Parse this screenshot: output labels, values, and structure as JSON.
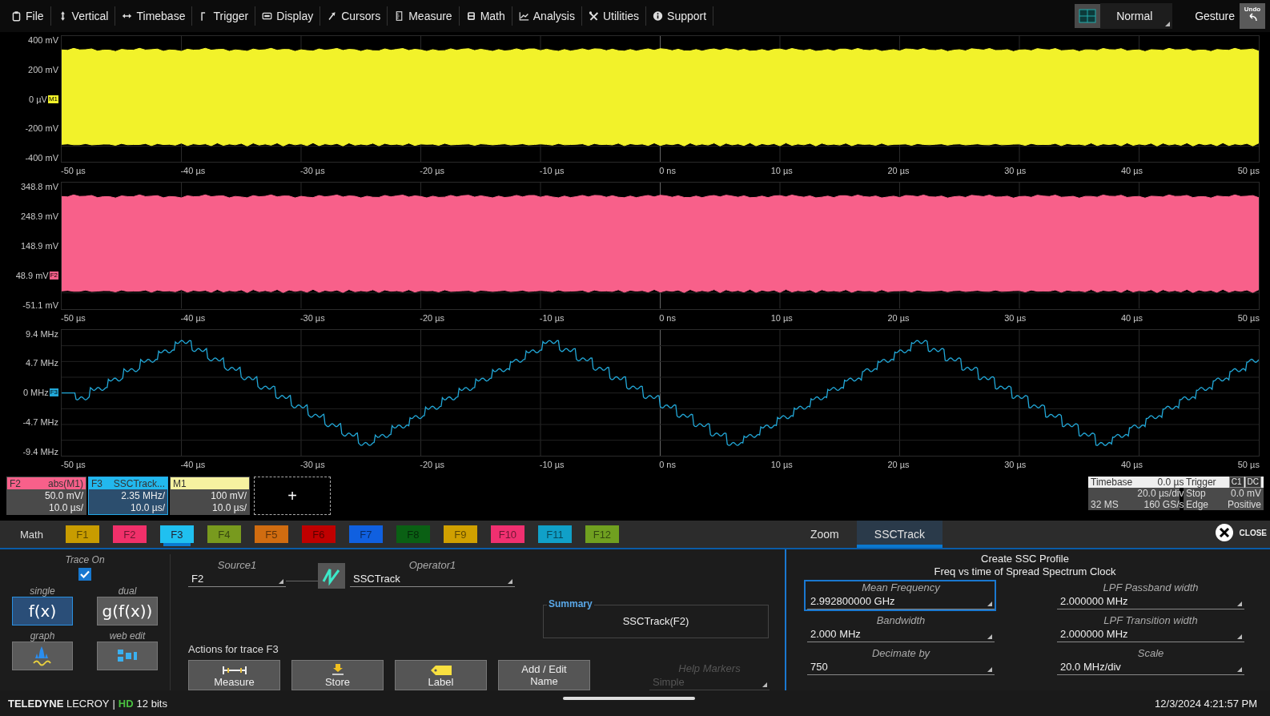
{
  "menu": [
    {
      "label": "File"
    },
    {
      "label": "Vertical"
    },
    {
      "label": "Timebase"
    },
    {
      "label": "Trigger"
    },
    {
      "label": "Display"
    },
    {
      "label": "Cursors"
    },
    {
      "label": "Measure"
    },
    {
      "label": "Math"
    },
    {
      "label": "Analysis"
    },
    {
      "label": "Utilities"
    },
    {
      "label": "Support"
    }
  ],
  "display_mode": "Normal",
  "gesture": "Gesture",
  "undo": "Undo",
  "grids": [
    {
      "kind": "band",
      "color": "#f2f22a",
      "y_labels": [
        {
          "text": "400 mV"
        },
        {
          "text": "200 mV"
        },
        {
          "text": "0 µV",
          "marker": "M1"
        },
        {
          "text": "-200 mV"
        },
        {
          "text": "-400 mV"
        }
      ],
      "x_labels": [
        "-50 µs",
        "-40 µs",
        "-30 µs",
        "-20 µs",
        "-10 µs",
        "0 ns",
        "10 µs",
        "20 µs",
        "30 µs",
        "40 µs",
        "50 µs"
      ]
    },
    {
      "kind": "band",
      "color": "#f8608a",
      "y_labels": [
        {
          "text": "348.8 mV"
        },
        {
          "text": "248.9 mV"
        },
        {
          "text": "148.9 mV"
        },
        {
          "text": "48.9 mV",
          "marker": "F2"
        },
        {
          "text": "-51.1 mV"
        }
      ],
      "x_labels": [
        "-50 µs",
        "-40 µs",
        "-30 µs",
        "-20 µs",
        "-10 µs",
        "0 ns",
        "10 µs",
        "20 µs",
        "30 µs",
        "40 µs",
        "50 µs"
      ]
    },
    {
      "kind": "staircase",
      "color": "#22a8d8",
      "y_labels": [
        {
          "text": "9.4 MHz"
        },
        {
          "text": "4.7 MHz"
        },
        {
          "text": "0 MHz",
          "marker": "F3"
        },
        {
          "text": "-4.7 MHz"
        },
        {
          "text": "-9.4 MHz"
        }
      ],
      "x_labels": [
        "-50 µs",
        "-40 µs",
        "-30 µs",
        "-20 µs",
        "-10 µs",
        "0 ns",
        "10 µs",
        "20 µs",
        "30 µs",
        "40 µs",
        "50 µs"
      ]
    }
  ],
  "descriptors": [
    {
      "name": "F2",
      "source": "abs(M1)",
      "color": "#f8608a",
      "scale": "50.0 mV/",
      "time": "10.0 µs/",
      "selected": false
    },
    {
      "name": "F3",
      "source": "SSCTrack...",
      "color": "#22b8ee",
      "scale": "2.35 MHz/",
      "time": "10.0 µs/",
      "selected": true
    },
    {
      "name": "M1",
      "color": "#f6f2a0",
      "scale": "100 mV/",
      "time": "10.0 µs/",
      "selected": false
    }
  ],
  "add_trace": "+",
  "timebase": {
    "title": "Timebase",
    "delay": "0.0 µs",
    "scale": "20.0 µs/div",
    "samples": "32 MS",
    "rate": "160 GS/s"
  },
  "trigger": {
    "title": "Trigger",
    "source": "C1",
    "coupling": "DC",
    "mode": "Stop",
    "level": "0.0 mV",
    "type": "Edge",
    "slope": "Positive"
  },
  "math_label": "Math",
  "function_tabs": [
    {
      "label": "F1",
      "color": "#c89c00",
      "selected": false
    },
    {
      "label": "F2",
      "color": "#f0306a",
      "selected": false
    },
    {
      "label": "F3",
      "color": "#20c0f0",
      "selected": true
    },
    {
      "label": "F4",
      "color": "#789a1e",
      "selected": false
    },
    {
      "label": "F5",
      "color": "#d06c10",
      "selected": false
    },
    {
      "label": "F6",
      "color": "#c00000",
      "selected": false
    },
    {
      "label": "F7",
      "color": "#1060e0",
      "selected": false
    },
    {
      "label": "F8",
      "color": "#0a6014",
      "selected": false
    },
    {
      "label": "F9",
      "color": "#d0a000",
      "selected": false
    },
    {
      "label": "F10",
      "color": "#f03070",
      "selected": false
    },
    {
      "label": "F11",
      "color": "#10a0c8",
      "selected": false
    },
    {
      "label": "F12",
      "color": "#70a020",
      "selected": false
    }
  ],
  "dialog_tabs": [
    {
      "label": "Zoom",
      "selected": false
    },
    {
      "label": "SSCTrack",
      "selected": true
    }
  ],
  "close": "CLOSE",
  "trace_on": {
    "label": "Trace On",
    "checked": true
  },
  "modes": [
    {
      "label": "single",
      "button": "f(x)",
      "kind": "text",
      "selected": true
    },
    {
      "label": "dual",
      "button": "g(f(x))",
      "kind": "text",
      "selected": false
    },
    {
      "label": "graph",
      "kind": "graph",
      "selected": false
    },
    {
      "label": "web edit",
      "kind": "web",
      "selected": false
    }
  ],
  "source": {
    "label": "Source1",
    "value": "F2"
  },
  "operator": {
    "label": "Operator1",
    "value": "SSCTrack"
  },
  "summary": {
    "label": "Summary",
    "value": "SSCTrack(F2)"
  },
  "actions_label": "Actions for trace F3",
  "actions": [
    {
      "label": "Measure",
      "kind": "measure"
    },
    {
      "label": "Store",
      "kind": "store"
    },
    {
      "label": "Label",
      "kind": "label"
    },
    {
      "label": "Add / Edit Name",
      "kind": "text"
    }
  ],
  "help_markers": {
    "label": "Help Markers",
    "value": "Simple",
    "disabled": true
  },
  "ssc": {
    "title": "Create SSC Profile",
    "subtitle": "Freq vs time of Spread Spectrum Clock",
    "fields": [
      {
        "label": "Mean Frequency",
        "value": "2.992800000 GHz",
        "selected": true
      },
      {
        "label": "LPF Passband width",
        "value": "2.000000 MHz",
        "selected": false
      },
      {
        "label": "Bandwidth",
        "value": "2.000 MHz",
        "selected": false
      },
      {
        "label": "LPF Transition width",
        "value": "2.000000 MHz",
        "selected": false
      },
      {
        "label": "Decimate by",
        "value": "750",
        "selected": false
      },
      {
        "label": "Scale",
        "value": "20.0 MHz/div",
        "selected": false
      }
    ]
  },
  "brand": "**TELEDYNE** LECROY",
  "brand_sep": "|",
  "hd": "HD",
  "bits": "12 bits",
  "datetime": "12/3/2024 4:21:57 PM"
}
